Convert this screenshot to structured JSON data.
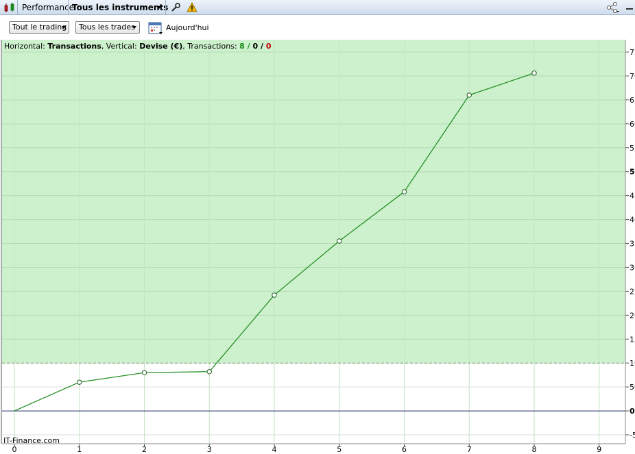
{
  "titlebar": {
    "tab_performance": "Performance",
    "instrument_selector": "Tous les instruments",
    "icons": [
      "candlestick-icon",
      "wrench-icon",
      "warning-icon",
      "share-icon",
      "minimize-icon"
    ]
  },
  "toolbar": {
    "period_dropdown": "Tout le trading",
    "trades_dropdown": "Tous les trades",
    "date_label": "Aujourd'hui"
  },
  "info": {
    "horizontal_label": "Horizontal: ",
    "horizontal_value": "Transactions",
    "vertical_label": ", Vertical: ",
    "vertical_value": "Devise (€)",
    "transactions_label": ", Transactions: ",
    "count_win": "8",
    "slash1": " / ",
    "count_neutral": "0",
    "slash2": " / ",
    "count_loss": "0"
  },
  "footer": {
    "source": "IT-Finance.com"
  },
  "colors": {
    "area_fill": "#cdf0cd",
    "line": "#1a8a1a",
    "win": "#1a8a1a",
    "loss": "#c00000",
    "zero_line": "#1b2a6b"
  },
  "chart_data": {
    "type": "line",
    "x_label": "Transactions",
    "y_label": "Devise (€)",
    "x": [
      0,
      1,
      2,
      3,
      4,
      5,
      6,
      7,
      8
    ],
    "series": [
      {
        "values": [
          0,
          60,
          80,
          82,
          242,
          355,
          458,
          660,
          706
        ]
      }
    ],
    "xlim": [
      0,
      9
    ],
    "ylim": [
      -50,
      750
    ],
    "y_ticks": [
      "750",
      "700",
      "650",
      "600",
      "550",
      "500",
      "450",
      "400",
      "350",
      "300",
      "250",
      "200",
      "150",
      "100",
      "50",
      "0",
      "-50"
    ],
    "x_ticks": [
      "0",
      "1",
      "2",
      "3",
      "4",
      "5",
      "6",
      "7",
      "8",
      "9"
    ],
    "reference_line_value": 100,
    "grid": true
  }
}
